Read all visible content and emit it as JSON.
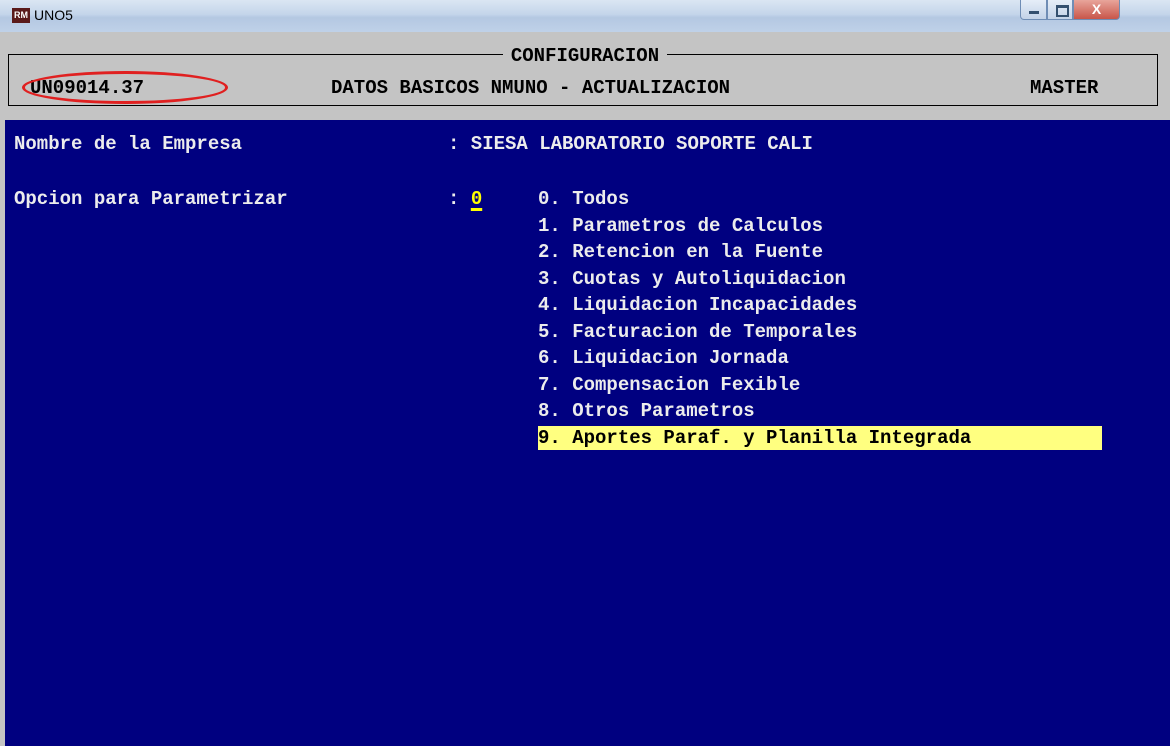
{
  "window": {
    "title": "UNO5",
    "icon": "app-logo-icon",
    "close_glyph": "X"
  },
  "header": {
    "caption": "CONFIGURACION",
    "program_code": "UN09014.37",
    "subtitle": "DATOS BASICOS NMUNO - ACTUALIZACION",
    "mode": "MASTER"
  },
  "form": {
    "company_label": "Nombre de la Empresa",
    "company_value": ": SIESA LABORATORIO SOPORTE CALI",
    "option_label": "Opcion para Parametrizar",
    "option_prefix": ": ",
    "option_value": "0"
  },
  "options": [
    "0. Todos",
    "1. Parametros de Calculos",
    "2. Retencion en la Fuente",
    "3. Cuotas y Autoliquidacion",
    "4. Liquidacion Incapacidades",
    "5. Facturacion de Temporales",
    "6. Liquidacion Jornada",
    "7. Compensacion Fexible",
    "8. Otros Parametros",
    "9. Aportes Paraf. y Planilla Integrada"
  ],
  "highlighted_option_index": 9,
  "colors": {
    "background": "#000080",
    "highlight": "#ffff80",
    "annotation": "#e02020"
  }
}
